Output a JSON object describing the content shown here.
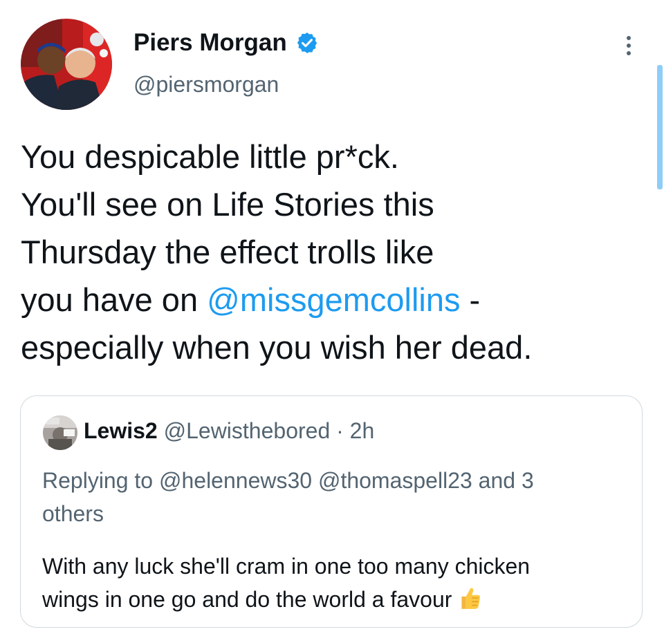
{
  "author": {
    "display_name": "Piers Morgan",
    "handle": "@piersmorgan",
    "verified_icon": "verified-badge-icon",
    "avatar_icon": "avatar"
  },
  "menu": {
    "icon": "more-options-icon"
  },
  "tweet": {
    "lines": [
      "You despicable little pr*ck.",
      "You'll see on Life Stories this",
      "Thursday the effect trolls like"
    ],
    "line4_prefix": "you have on ",
    "line4_mention": "@missgemcollins",
    "line4_suffix": " -",
    "line5": "especially when you wish her dead."
  },
  "quoted_tweet": {
    "display_name": "Lewis2",
    "handle": "@Lewisthebored",
    "separator": "·",
    "time": "2h",
    "replying_prefix": "Replying to ",
    "replying_mention_1": "@helennews30",
    "replying_mention_2": "@thomaspell23",
    "replying_others": "and 3",
    "replying_others_2": "others",
    "text_line_1": "With any luck she'll cram in one too many chicken",
    "text_line_2": "wings in one go and do the world a favour",
    "emoji": "thumbs-up-icon"
  },
  "colors": {
    "link": "#1d9bf0",
    "secondary_text": "#536471",
    "primary_text": "#0f1419",
    "border": "#cfd9de",
    "scrollbar": "#8ecdf8"
  }
}
